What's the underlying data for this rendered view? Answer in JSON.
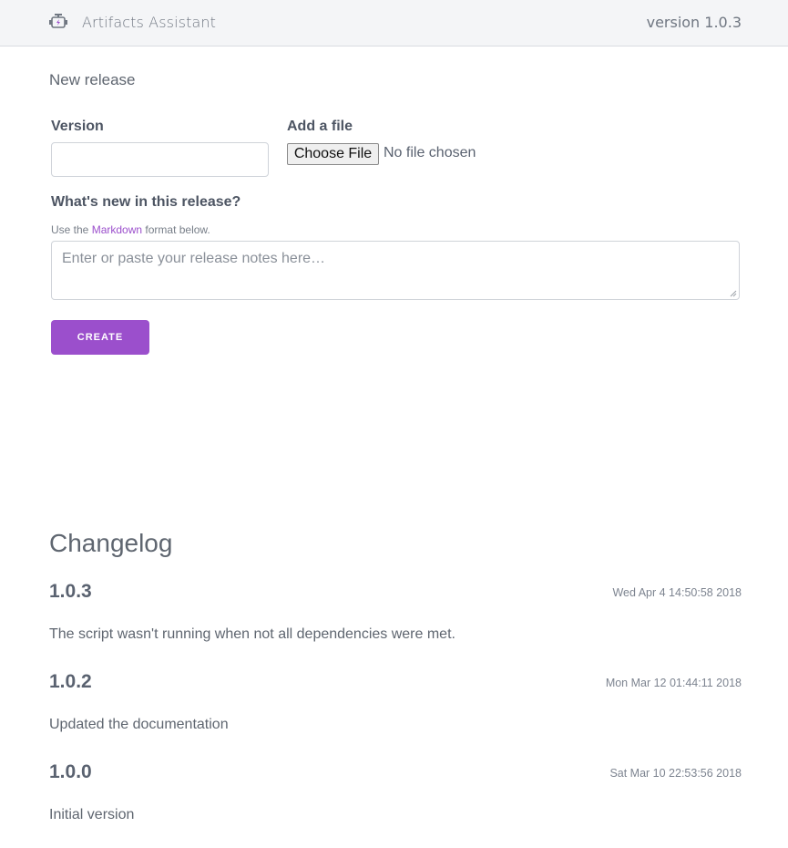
{
  "header": {
    "app_name": "Artifacts Assistant",
    "version_label": "version 1.0.3",
    "logo_icon": "engine-icon"
  },
  "new_release": {
    "title": "New release",
    "version_label": "Version",
    "version_value": "",
    "file_label": "Add a file",
    "file_button": "Choose File",
    "file_status": "No file chosen",
    "notes_label": "What's new in this release?",
    "hint_prefix": "Use the ",
    "hint_link": "Markdown",
    "hint_suffix": " format below.",
    "notes_placeholder": "Enter or paste your release notes here…",
    "notes_value": "",
    "create_button": "CREATE"
  },
  "changelog": {
    "title": "Changelog",
    "entries": [
      {
        "version": "1.0.3",
        "date": "Wed Apr 4 14:50:58 2018",
        "note": "The script wasn't running when not all dependencies were met."
      },
      {
        "version": "1.0.2",
        "date": "Mon Mar 12 01:44:11 2018",
        "note": "Updated the documentation"
      },
      {
        "version": "1.0.0",
        "date": "Sat Mar 10 22:53:56 2018",
        "note": "Initial version"
      }
    ]
  },
  "colors": {
    "accent": "#9b4fcc",
    "header_bg": "#f4f5f7",
    "text": "#5a6270"
  }
}
